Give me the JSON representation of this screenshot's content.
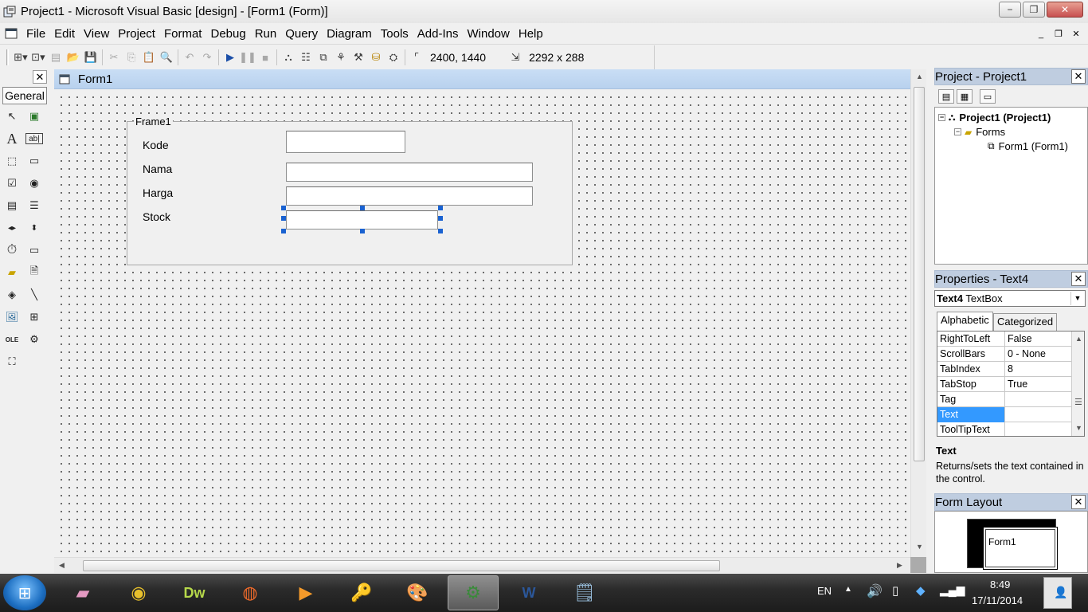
{
  "window": {
    "title": "Project1 - Microsoft Visual Basic [design] - [Form1 (Form)]",
    "minimize": "−",
    "maximize": "❐",
    "close": "✕"
  },
  "menu": {
    "items": [
      "File",
      "Edit",
      "View",
      "Project",
      "Format",
      "Debug",
      "Run",
      "Query",
      "Diagram",
      "Tools",
      "Add-Ins",
      "Window",
      "Help"
    ],
    "mdi_minimize": "_",
    "mdi_restore": "❐",
    "mdi_close": "✕"
  },
  "toolbar": {
    "position": "2400, 1440",
    "size": "2292 x 288"
  },
  "toolbox": {
    "close": "✕",
    "tab": "General",
    "tools": [
      "pointer-icon",
      "picturebox-icon",
      "label-icon",
      "textbox-icon",
      "frame-icon",
      "commandbutton-icon",
      "checkbox-icon",
      "optionbutton-icon",
      "combobox-icon",
      "listbox-icon",
      "hscrollbar-icon",
      "vscrollbar-icon",
      "timer-icon",
      "drivelistbox-icon",
      "dirlistbox-icon",
      "filelistbox-icon",
      "shape-icon",
      "line-icon",
      "image-icon",
      "data-icon",
      "ole-icon",
      "datagrid-icon",
      "adodc-icon"
    ]
  },
  "form": {
    "caption": "Form1",
    "frame_caption": "Frame1",
    "labels": [
      "Kode",
      "Nama",
      "Harga",
      "Stock"
    ]
  },
  "project_explorer": {
    "title": "Project - Project1",
    "close": "✕",
    "project": "Project1 (Project1)",
    "folder": "Forms",
    "form": "Form1 (Form1)"
  },
  "properties": {
    "title": "Properties - Text4",
    "close": "✕",
    "object_name": "Text4",
    "object_type": "TextBox",
    "tabs": [
      "Alphabetic",
      "Categorized"
    ],
    "rows": [
      {
        "name": "RightToLeft",
        "value": "False"
      },
      {
        "name": "ScrollBars",
        "value": "0 - None"
      },
      {
        "name": "TabIndex",
        "value": "8"
      },
      {
        "name": "TabStop",
        "value": "True"
      },
      {
        "name": "Tag",
        "value": ""
      },
      {
        "name": "Text",
        "value": ""
      },
      {
        "name": "ToolTipText",
        "value": ""
      }
    ],
    "selected": "Text",
    "description_title": "Text",
    "description": "Returns/sets the text contained in the control."
  },
  "form_layout": {
    "title": "Form Layout",
    "close": "✕",
    "form_label": "Form1"
  },
  "taskbar": {
    "language": "EN",
    "time": "8:49",
    "date": "17/11/2014"
  },
  "colors": {
    "selection": "#3399ff",
    "handle": "#1a62d1",
    "pane_title": "#bfcde0"
  }
}
